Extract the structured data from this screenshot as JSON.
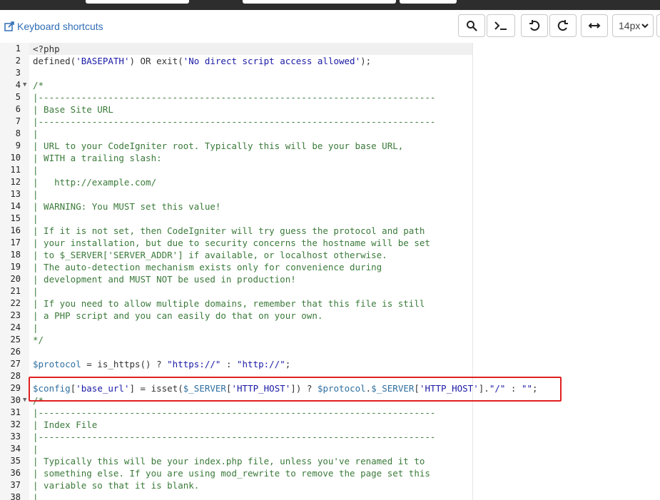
{
  "toolbar": {
    "keyboard_shortcuts_label": "Keyboard shortcuts",
    "font_size_value": "14px",
    "buttons": [
      "search-icon",
      "terminal-icon",
      "undo-icon",
      "redo-icon",
      "wrap-icon"
    ]
  },
  "editor": {
    "lines": [
      {
        "n": "1",
        "code": "<?php",
        "fold": false
      },
      {
        "n": "2",
        "code": "defined('BASEPATH') OR exit('No direct script access allowed');",
        "fold": false
      },
      {
        "n": "3",
        "code": "",
        "fold": false
      },
      {
        "n": "4",
        "code": "/*",
        "fold": true
      },
      {
        "n": "5",
        "code": "|--------------------------------------------------------------------------",
        "fold": false
      },
      {
        "n": "6",
        "code": "| Base Site URL",
        "fold": false
      },
      {
        "n": "7",
        "code": "|--------------------------------------------------------------------------",
        "fold": false
      },
      {
        "n": "8",
        "code": "|",
        "fold": false
      },
      {
        "n": "9",
        "code": "| URL to your CodeIgniter root. Typically this will be your base URL,",
        "fold": false
      },
      {
        "n": "10",
        "code": "| WITH a trailing slash:",
        "fold": false
      },
      {
        "n": "11",
        "code": "|",
        "fold": false
      },
      {
        "n": "12",
        "code": "|   http://example.com/",
        "fold": false
      },
      {
        "n": "13",
        "code": "|",
        "fold": false
      },
      {
        "n": "14",
        "code": "| WARNING: You MUST set this value!",
        "fold": false
      },
      {
        "n": "15",
        "code": "|",
        "fold": false
      },
      {
        "n": "16",
        "code": "| If it is not set, then CodeIgniter will try guess the protocol and path",
        "fold": false
      },
      {
        "n": "17",
        "code": "| your installation, but due to security concerns the hostname will be set",
        "fold": false
      },
      {
        "n": "18",
        "code": "| to $_SERVER['SERVER_ADDR'] if available, or localhost otherwise.",
        "fold": false
      },
      {
        "n": "19",
        "code": "| The auto-detection mechanism exists only for convenience during",
        "fold": false
      },
      {
        "n": "20",
        "code": "| development and MUST NOT be used in production!",
        "fold": false
      },
      {
        "n": "21",
        "code": "|",
        "fold": false
      },
      {
        "n": "22",
        "code": "| If you need to allow multiple domains, remember that this file is still",
        "fold": false
      },
      {
        "n": "23",
        "code": "| a PHP script and you can easily do that on your own.",
        "fold": false
      },
      {
        "n": "24",
        "code": "|",
        "fold": false
      },
      {
        "n": "25",
        "code": "*/",
        "fold": false
      },
      {
        "n": "26",
        "code": "",
        "fold": false
      },
      {
        "n": "27",
        "code": "$protocol = is_https() ? \"https://\" : \"http://\";",
        "fold": false
      },
      {
        "n": "28",
        "code": "",
        "fold": false
      },
      {
        "n": "29",
        "code": "$config['base_url'] = isset($_SERVER['HTTP_HOST']) ? $protocol.$_SERVER['HTTP_HOST'].\"/\" : \"\";",
        "fold": false
      },
      {
        "n": "30",
        "code": "/*",
        "fold": true
      },
      {
        "n": "31",
        "code": "|--------------------------------------------------------------------------",
        "fold": false
      },
      {
        "n": "32",
        "code": "| Index File",
        "fold": false
      },
      {
        "n": "33",
        "code": "|--------------------------------------------------------------------------",
        "fold": false
      },
      {
        "n": "34",
        "code": "|",
        "fold": false
      },
      {
        "n": "35",
        "code": "| Typically this will be your index.php file, unless you've renamed it to",
        "fold": false
      },
      {
        "n": "36",
        "code": "| something else. If you are using mod_rewrite to remove the page set this",
        "fold": false
      },
      {
        "n": "37",
        "code": "| variable so that it is blank.",
        "fold": false
      },
      {
        "n": "38",
        "code": "|",
        "fold": false
      }
    ]
  },
  "colors": {
    "comment": "#3a7a3a",
    "string": "#1a1aa6",
    "variable": "#2f6fa0",
    "highlight_border": "#e02020",
    "link": "#2f6db5"
  }
}
